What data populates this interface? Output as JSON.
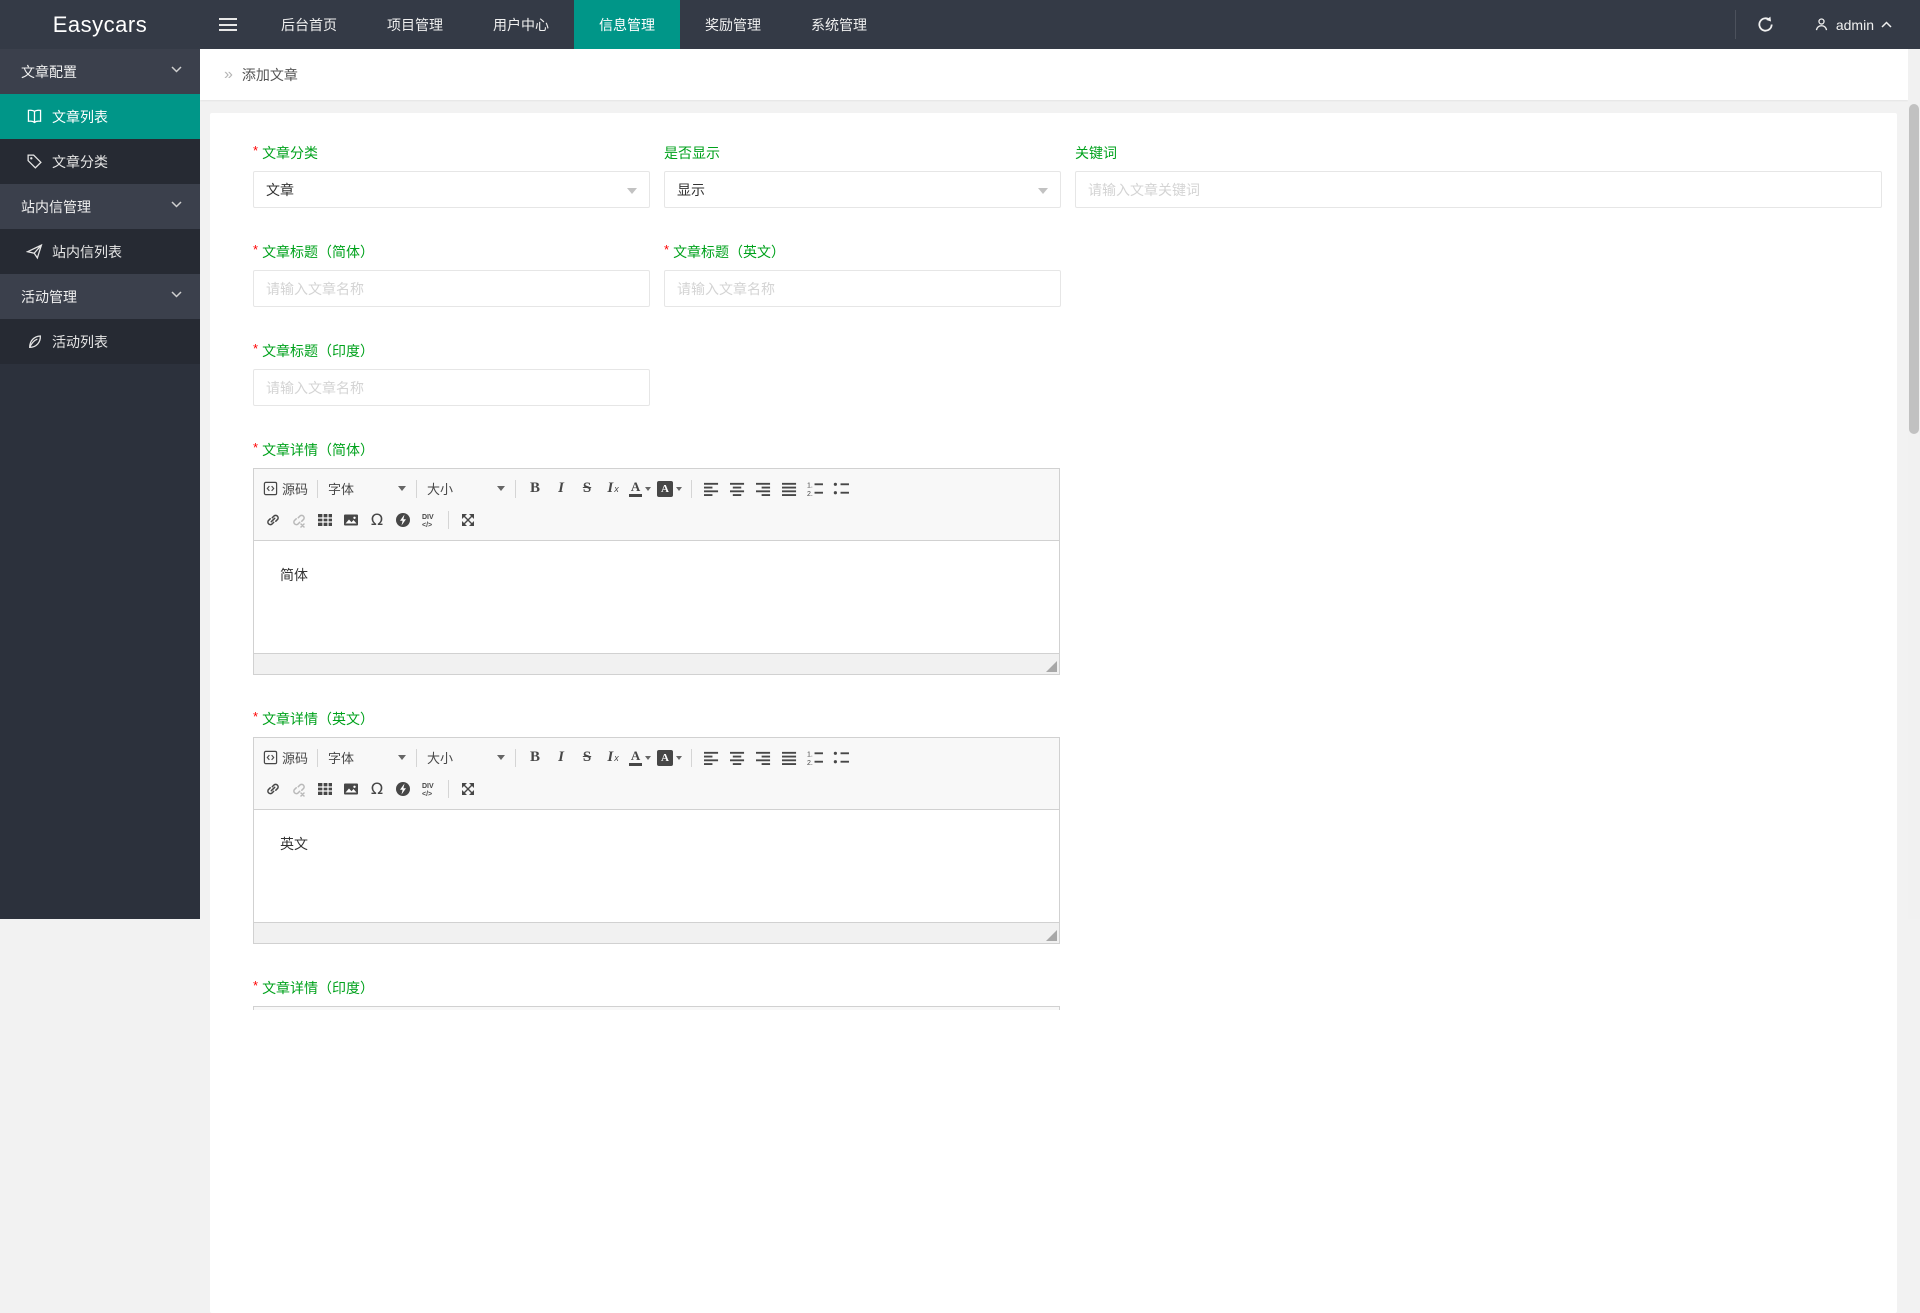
{
  "colors": {
    "accent_teal": "#009688",
    "label_green": "#00a21c",
    "required_red": "#ff0000",
    "header_bg": "#343a46",
    "sidebar_group_bg": "#3b404c",
    "sidebar_item_bg": "#262a33"
  },
  "header": {
    "logo": "Easycars",
    "nav": [
      {
        "label": "后台首页",
        "active": false
      },
      {
        "label": "项目管理",
        "active": false
      },
      {
        "label": "用户中心",
        "active": false
      },
      {
        "label": "信息管理",
        "active": true
      },
      {
        "label": "奖励管理",
        "active": false
      },
      {
        "label": "系统管理",
        "active": false
      }
    ],
    "user": {
      "name": "admin"
    }
  },
  "sidebar": {
    "groups": [
      {
        "label": "文章配置",
        "expanded": true,
        "items": [
          {
            "label": "文章列表",
            "icon": "book-icon",
            "active": true
          },
          {
            "label": "文章分类",
            "icon": "tag-icon",
            "active": false
          }
        ]
      },
      {
        "label": "站内信管理",
        "expanded": true,
        "items": [
          {
            "label": "站内信列表",
            "icon": "paper-plane-icon",
            "active": false
          }
        ]
      },
      {
        "label": "活动管理",
        "expanded": true,
        "items": [
          {
            "label": "活动列表",
            "icon": "leaf-icon",
            "active": false
          }
        ]
      }
    ]
  },
  "breadcrumb": {
    "separator": "»",
    "current": "添加文章"
  },
  "form": {
    "required_mark": "*",
    "category": {
      "label": "文章分类",
      "required": true,
      "value": "文章"
    },
    "visible": {
      "label": "是否显示",
      "required": false,
      "value": "显示"
    },
    "keyword": {
      "label": "关键词",
      "required": false,
      "placeholder": "请输入文章关键词"
    },
    "title_cn": {
      "label": "文章标题（简体）",
      "required": true,
      "placeholder": "请输入文章名称"
    },
    "title_en": {
      "label": "文章标题（英文）",
      "required": true,
      "placeholder": "请输入文章名称"
    },
    "title_in": {
      "label": "文章标题（印度）",
      "required": true,
      "placeholder": "请输入文章名称"
    },
    "detail_cn": {
      "label": "文章详情（简体）",
      "required": true,
      "content": "简体"
    },
    "detail_en": {
      "label": "文章详情（英文）",
      "required": true,
      "content": "英文"
    },
    "detail_in": {
      "label": "文章详情（印度）",
      "required": true
    }
  },
  "editor_toolbar": {
    "source": "源码",
    "font": "字体",
    "size": "大小"
  }
}
